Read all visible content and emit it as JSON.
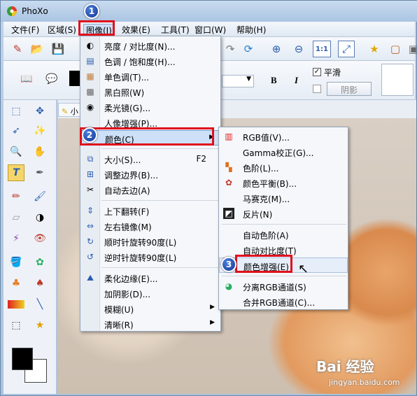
{
  "app": {
    "title": "PhoXo"
  },
  "menubar": [
    {
      "label": "文件(F)"
    },
    {
      "label": "区域(S)"
    },
    {
      "label": "图像(I)"
    },
    {
      "label": "效果(E)"
    },
    {
      "label": "工具(T)"
    },
    {
      "label": "窗口(W)"
    },
    {
      "label": "帮助(H)"
    }
  ],
  "textbar": {
    "bold_label": "B",
    "italic_label": "I",
    "smooth_label": "平滑",
    "shadow_label": "阴影"
  },
  "doc_tab": {
    "label": "小"
  },
  "image_menu": {
    "items": [
      {
        "label": "亮度 / 对比度(N)...",
        "icon": "contrast-icon"
      },
      {
        "label": "色调 / 饱和度(H)...",
        "icon": "hue-icon"
      },
      {
        "label": "单色调(T)...",
        "icon": "monotone-icon"
      },
      {
        "label": "黑白照(W)",
        "icon": "grayscale-icon"
      },
      {
        "label": "柔光镜(G)...",
        "icon": "softlight-icon"
      },
      {
        "label": "人像增强(P)...",
        "icon": ""
      },
      {
        "label": "颜色(C)",
        "icon": ""
      },
      {
        "label": "大小(S)...",
        "icon": "resize-icon",
        "shortcut": "F2"
      },
      {
        "label": "调整边界(B)...",
        "icon": "border-icon"
      },
      {
        "label": "自动去边(A)",
        "icon": "autocrop-icon"
      },
      {
        "label": "上下翻转(F)",
        "icon": "flip-vertical-icon"
      },
      {
        "label": "左右镜像(M)",
        "icon": "mirror-icon"
      },
      {
        "label": "顺时针旋转90度(L)",
        "icon": "rotate-cw-icon"
      },
      {
        "label": "逆时针旋转90度(L)",
        "icon": "rotate-ccw-icon"
      },
      {
        "label": "柔化边缘(E)...",
        "icon": "soften-edge-icon"
      },
      {
        "label": "加阴影(D)...",
        "icon": ""
      },
      {
        "label": "模糊(U)",
        "icon": ""
      },
      {
        "label": "清晰(R)",
        "icon": ""
      }
    ]
  },
  "color_menu": {
    "items": [
      {
        "label": "RGB值(V)...",
        "icon": "rgb-icon"
      },
      {
        "label": "Gamma校正(G)...",
        "icon": ""
      },
      {
        "label": "色阶(L)...",
        "icon": "levels-icon"
      },
      {
        "label": "颜色平衡(B)...",
        "icon": "color-balance-icon"
      },
      {
        "label": "马赛克(M)...",
        "icon": ""
      },
      {
        "label": "反片(N)",
        "icon": "invert-icon"
      },
      {
        "label": "自动色阶(A)",
        "icon": ""
      },
      {
        "label": "自动对比度(T)",
        "icon": ""
      },
      {
        "label": "颜色增强(E)",
        "icon": ""
      },
      {
        "label": "分离RGB通道(S)",
        "icon": "split-rgb-icon"
      },
      {
        "label": "合并RGB通道(C)...",
        "icon": ""
      }
    ]
  },
  "steps": [
    "1",
    "2",
    "3"
  ],
  "watermark": {
    "brand": "Bai 经验",
    "url": "jingyan.baidu.com"
  }
}
